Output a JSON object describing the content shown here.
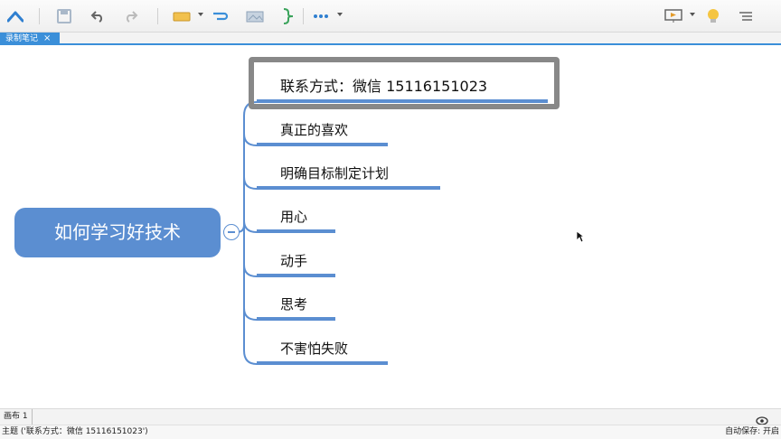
{
  "toolbar": {
    "icons": [
      "home-icon",
      "save-icon",
      "undo-icon",
      "redo-icon",
      "insert-topic-icon",
      "relationship-icon",
      "image-icon",
      "summary-icon",
      "more-icon",
      "presentation-icon",
      "idea-icon",
      "outline-icon"
    ]
  },
  "tabs": [
    {
      "label": "录制笔记",
      "close": "×"
    }
  ],
  "mindmap": {
    "root": "如何学习好技术",
    "topics": [
      "联系方式：微信  15116151023",
      "真正的喜欢",
      "明确目标制定计划",
      "用心",
      "动手",
      "思考",
      "不害怕失败"
    ]
  },
  "colors": {
    "accent": "#5b8ed1",
    "tab": "#3b8fd9",
    "selection": "#888888"
  },
  "sheet": {
    "label": "画布 1"
  },
  "status": {
    "left": "主题 ('联系方式：微信  15116151023')",
    "right": "自动保存: 开启"
  }
}
